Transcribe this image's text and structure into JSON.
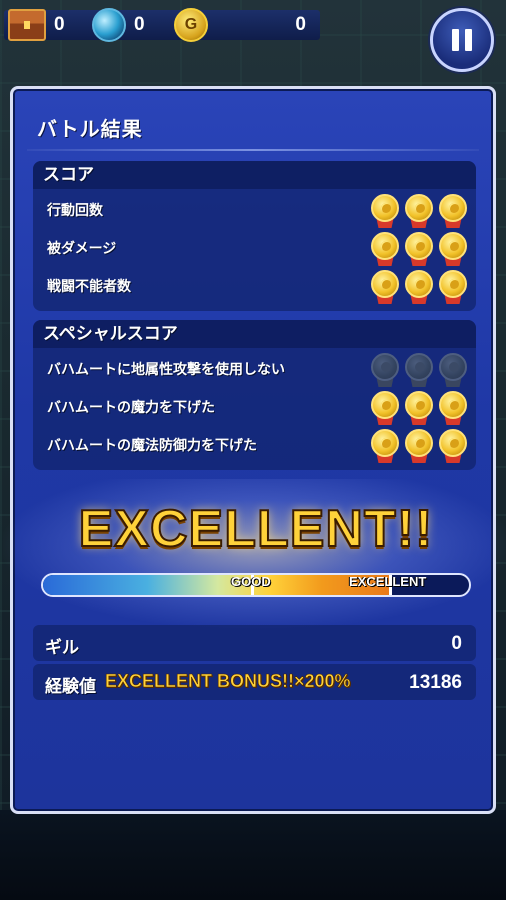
{
  "hud": {
    "chest_count": "0",
    "orb_count": "0",
    "gil_symbol": "G",
    "gil_count": "0"
  },
  "panel": {
    "title": "バトル結果"
  },
  "score": {
    "header": "スコア",
    "rows": [
      {
        "label": "行動回数",
        "medals_earned": 3,
        "medals_total": 3
      },
      {
        "label": "被ダメージ",
        "medals_earned": 3,
        "medals_total": 3
      },
      {
        "label": "戦闘不能者数",
        "medals_earned": 3,
        "medals_total": 3
      }
    ]
  },
  "special": {
    "header": "スペシャルスコア",
    "rows": [
      {
        "label": "バハムートに地属性攻撃を使用しない",
        "medals_earned": 0,
        "medals_total": 3
      },
      {
        "label": "バハムートの魔力を下げた",
        "medals_earned": 3,
        "medals_total": 3
      },
      {
        "label": "バハムートの魔法防御力を下げた",
        "medals_earned": 3,
        "medals_total": 3
      }
    ]
  },
  "result": {
    "rank_text": "EXCELLENT!!",
    "gauge_fill_fraction": 0.82,
    "gauge_labels": [
      "GOOD",
      "EXCELLENT"
    ]
  },
  "rewards": {
    "gil_label": "ギル",
    "gil_value": "0",
    "exp_label": "経験値",
    "exp_bonus": "EXCELLENT BONUS!!×200%",
    "exp_value": "13186"
  },
  "colors": {
    "panel_blue": "#1f38a6",
    "medal_gold": "#f2c22a",
    "accent_yellow": "#ffd23a"
  }
}
